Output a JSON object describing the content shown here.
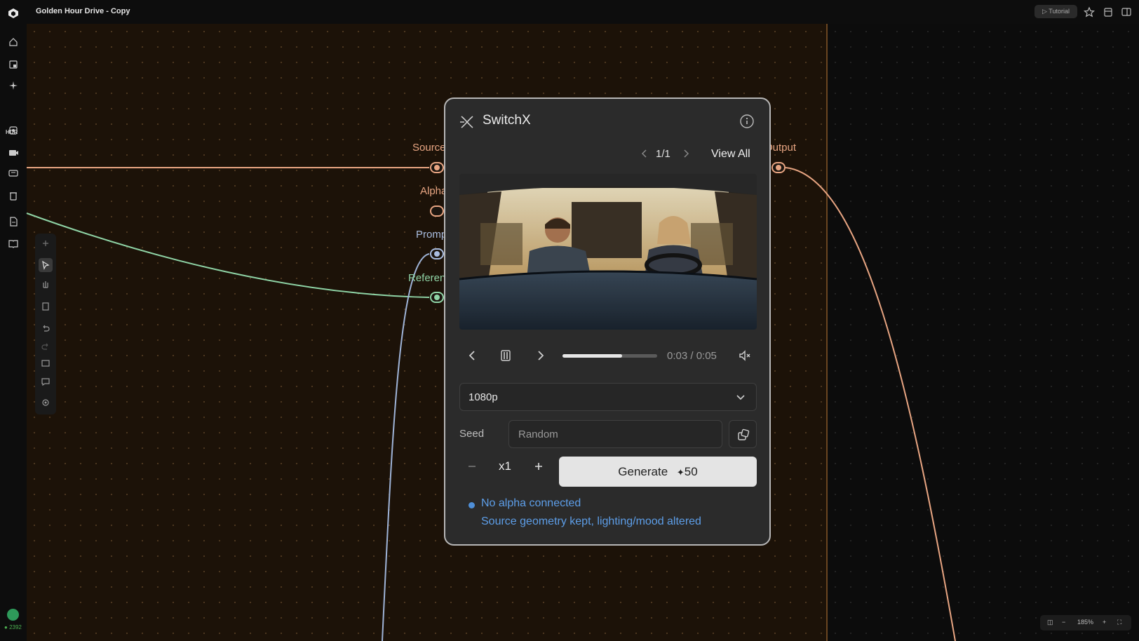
{
  "app": {
    "document_title": "Golden Hour Drive - Copy",
    "tutorial_label": "Tutorial",
    "credits": "2392",
    "zoom": "185%"
  },
  "leftrail": {
    "hdr_label": "HDR"
  },
  "node": {
    "title": "SwitchX",
    "pager": {
      "current": "1/1",
      "view_all": "View All"
    },
    "ports": {
      "source": "Source *",
      "alpha": "Alpha",
      "prompt": "Prompt",
      "reference": "Reference",
      "output": "Output"
    },
    "player": {
      "time": "0:03 / 0:05",
      "progress": 0.63
    },
    "resolution": "1080p",
    "seed": {
      "label": "Seed",
      "placeholder": "Random"
    },
    "multiplier": "x1",
    "generate": {
      "label": "Generate",
      "cost": "50"
    },
    "status": {
      "line1": "No alpha connected",
      "line2": "Source geometry kept, lighting/mood altered"
    }
  },
  "colors": {
    "source_wire": "#e8a582",
    "reference_wire": "#8fd4a6",
    "prompt_wire": "#9fb4d8",
    "output_wire": "#e8a582",
    "status_text": "#5d9ee8",
    "canvas_bg": "#1c1208"
  },
  "icons": [
    "logo-icon",
    "home-icon",
    "layers-icon",
    "sparkle-icon",
    "frame-icon",
    "video-icon",
    "chat-icon",
    "trash-icon",
    "document-icon",
    "book-icon",
    "pointer-icon",
    "hand-icon",
    "page-icon",
    "undo-icon",
    "redo-icon",
    "image-icon",
    "comment-icon",
    "gear-icon",
    "star-icon",
    "box-icon",
    "panel-icon",
    "switchx-icon",
    "info-icon",
    "chevron-left-icon",
    "chevron-right-icon",
    "pause-icon",
    "mute-icon",
    "chevron-down-icon",
    "dice-icon",
    "minus-icon",
    "plus-icon",
    "sparkle-small-icon"
  ]
}
